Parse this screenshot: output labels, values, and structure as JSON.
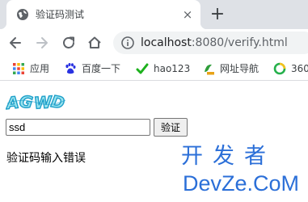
{
  "browser": {
    "tab": {
      "title": "验证码测试",
      "close_glyph": "×"
    },
    "new_tab_glyph": "+",
    "address": {
      "host": "localhost",
      "rest": ":8080/verify.html"
    }
  },
  "bookmarks": [
    {
      "label": "应用",
      "icon": "apps-grid-icon"
    },
    {
      "label": "百度一下",
      "icon": "baidu-paw-icon"
    },
    {
      "label": "hao123",
      "icon": "hao123-icon"
    },
    {
      "label": "网址导航",
      "icon": "web-nav-icon"
    },
    {
      "label": "360",
      "icon": "360-icon"
    }
  ],
  "page": {
    "input_value": "ssd",
    "verify_button": "验证",
    "error_message": "验证码输入错误"
  },
  "watermark": {
    "cn": "开发者",
    "en": "DevZe.CoM"
  },
  "colors": {
    "watermark": "#2b6fd8",
    "tabstrip": "#dee1e6",
    "omnibox": "#f1f3f4"
  }
}
